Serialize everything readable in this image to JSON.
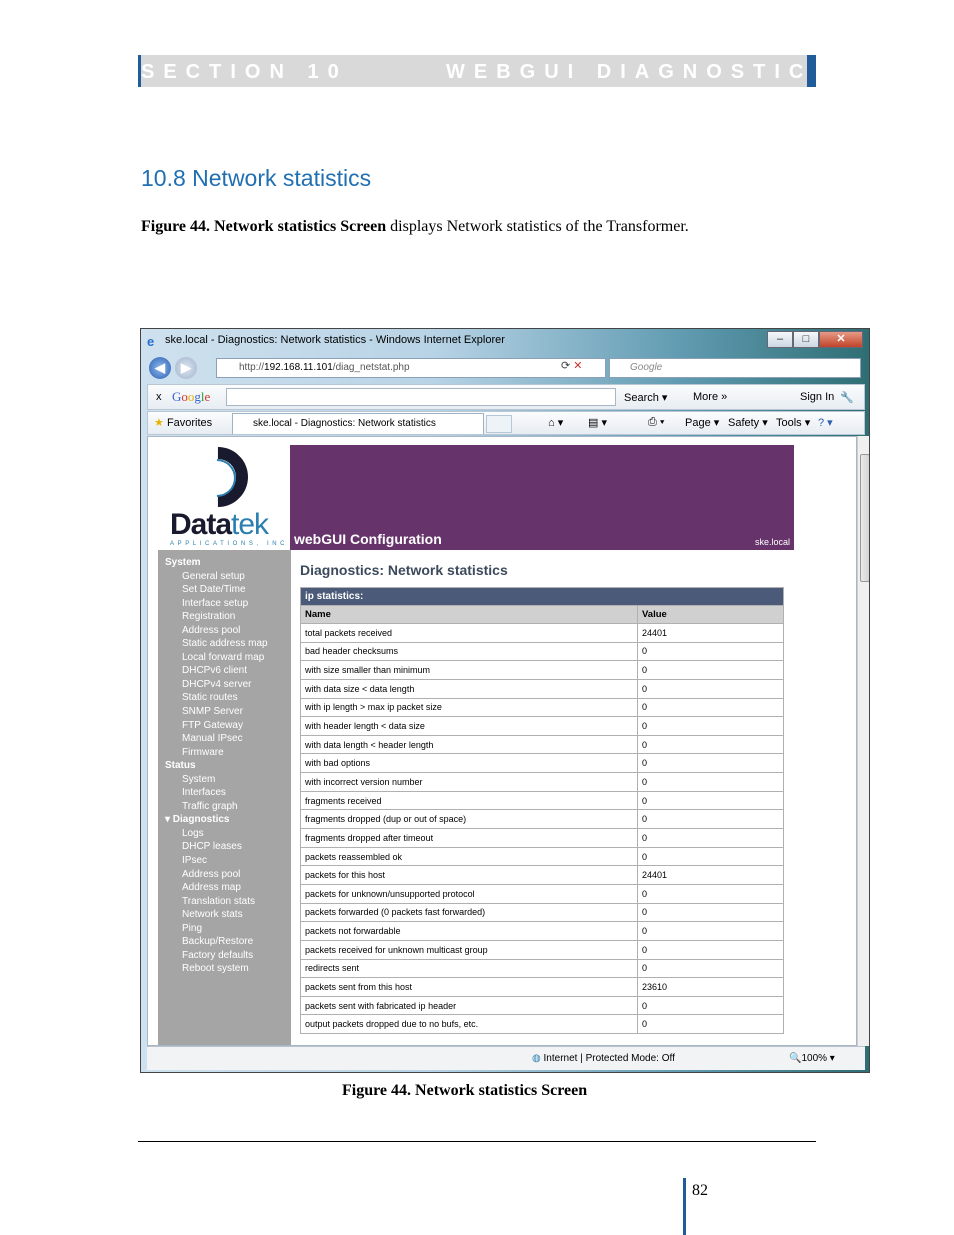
{
  "header": {
    "section_label": "SECTION 10",
    "section_title": "WEBGUI DIAGNOSTICS"
  },
  "heading": "10.8  Network statistics",
  "paragraph": {
    "bold": "Figure 44. Network statistics Screen",
    "rest": " displays Network statistics of the Transformer."
  },
  "browser": {
    "window_title": "ske.local - Diagnostics: Network statistics - Windows Internet Explorer",
    "url_prefix": "http://",
    "url_host": "192.168.11.101",
    "url_path": "/diag_netstat.php",
    "search_placeholder": "Google",
    "google_toolbar": {
      "search_label": "Search",
      "more_label": "More",
      "sign_in_label": "Sign In"
    },
    "favorites_label": "Favorites",
    "tab_title": "ske.local - Diagnostics: Network statistics",
    "commands": {
      "page": "Page",
      "safety": "Safety",
      "tools": "Tools"
    },
    "status_text": "Internet | Protected Mode: Off",
    "zoom": "100%"
  },
  "webgui": {
    "logo_word": "Data",
    "logo_word2": "tek",
    "logo_sub": "APPLICATIONS, INC",
    "banner_title": "webGUI Configuration",
    "banner_host": "ske.local",
    "menu": [
      {
        "label": "System",
        "type": "h"
      },
      {
        "label": "General setup",
        "type": "s"
      },
      {
        "label": "Set Date/Time",
        "type": "s"
      },
      {
        "label": "Interface setup",
        "type": "s"
      },
      {
        "label": "Registration",
        "type": "s"
      },
      {
        "label": "Address pool",
        "type": "s"
      },
      {
        "label": "Static address map",
        "type": "s"
      },
      {
        "label": "Local forward map",
        "type": "s"
      },
      {
        "label": "DHCPv6 client",
        "type": "s"
      },
      {
        "label": "DHCPv4 server",
        "type": "s"
      },
      {
        "label": "Static routes",
        "type": "s"
      },
      {
        "label": "SNMP Server",
        "type": "s"
      },
      {
        "label": "FTP Gateway",
        "type": "s"
      },
      {
        "label": "Manual IPsec",
        "type": "s"
      },
      {
        "label": "Firmware",
        "type": "s"
      },
      {
        "label": "Status",
        "type": "h"
      },
      {
        "label": "System",
        "type": "s"
      },
      {
        "label": "Interfaces",
        "type": "s"
      },
      {
        "label": "Traffic graph",
        "type": "s"
      },
      {
        "label": "▾ Diagnostics",
        "type": "h"
      },
      {
        "label": "Logs",
        "type": "s"
      },
      {
        "label": "DHCP leases",
        "type": "s"
      },
      {
        "label": "IPsec",
        "type": "s"
      },
      {
        "label": "Address pool",
        "type": "s"
      },
      {
        "label": "Address map",
        "type": "s"
      },
      {
        "label": "Translation stats",
        "type": "s"
      },
      {
        "label": "Network stats",
        "type": "s"
      },
      {
        "label": "Ping",
        "type": "s"
      },
      {
        "label": "Backup/Restore",
        "type": "s"
      },
      {
        "label": "Factory defaults",
        "type": "s"
      },
      {
        "label": "Reboot system",
        "type": "s"
      }
    ],
    "page_title": "Diagnostics: Network statistics",
    "table_caption": "ip statistics:",
    "columns": [
      "Name",
      "Value"
    ],
    "rows": [
      [
        "total packets received",
        "24401"
      ],
      [
        "bad header checksums",
        "0"
      ],
      [
        "with size smaller than minimum",
        "0"
      ],
      [
        "with data size < data length",
        "0"
      ],
      [
        "with ip length > max ip packet size",
        "0"
      ],
      [
        "with header length < data size",
        "0"
      ],
      [
        "with data length < header length",
        "0"
      ],
      [
        "with bad options",
        "0"
      ],
      [
        "with incorrect version number",
        "0"
      ],
      [
        "fragments received",
        "0"
      ],
      [
        "fragments dropped (dup or out of space)",
        "0"
      ],
      [
        "fragments dropped after timeout",
        "0"
      ],
      [
        "packets reassembled ok",
        "0"
      ],
      [
        "packets for this host",
        "24401"
      ],
      [
        "packets for unknown/unsupported protocol",
        "0"
      ],
      [
        "packets forwarded (0 packets fast forwarded)",
        "0"
      ],
      [
        "packets not forwardable",
        "0"
      ],
      [
        "packets received for unknown multicast group",
        "0"
      ],
      [
        "redirects sent",
        "0"
      ],
      [
        "packets sent from this host",
        "23610"
      ],
      [
        "packets sent with fabricated ip header",
        "0"
      ],
      [
        "output packets dropped due to no bufs, etc.",
        "0"
      ]
    ]
  },
  "caption": "Figure 44. Network statistics Screen",
  "page_number": "82"
}
